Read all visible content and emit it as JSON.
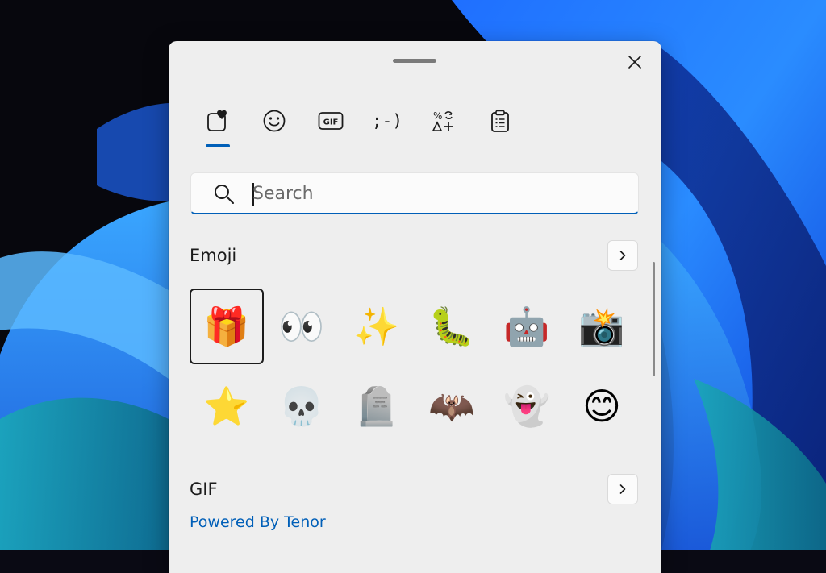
{
  "tabs": [
    {
      "name": "favorites",
      "icon": "heart-badge-icon"
    },
    {
      "name": "emoji",
      "icon": "smiley-icon"
    },
    {
      "name": "gif",
      "icon": "gif-icon",
      "label": "GIF"
    },
    {
      "name": "kaomoji",
      "icon": "kaomoji-icon",
      "label": ";-)"
    },
    {
      "name": "symbols",
      "icon": "symbols-icon"
    },
    {
      "name": "clipboard",
      "icon": "clipboard-icon"
    }
  ],
  "search": {
    "placeholder": "Search",
    "value": ""
  },
  "emoji_section": {
    "title": "Emoji"
  },
  "emoji": [
    {
      "char": "🎁",
      "selected": true
    },
    {
      "char": "👀"
    },
    {
      "char": "✨"
    },
    {
      "char": "🐛"
    },
    {
      "char": "🤖"
    },
    {
      "char": "📸"
    },
    {
      "char": "⭐"
    },
    {
      "char": "💀"
    },
    {
      "char": "🪦"
    },
    {
      "char": "🦇"
    },
    {
      "char": "👻"
    },
    {
      "char": "😊"
    }
  ],
  "gif_section": {
    "title": "GIF",
    "powered_by": "Powered By Tenor"
  },
  "colors": {
    "accent": "#005fb8",
    "panel": "#eeeeee"
  }
}
